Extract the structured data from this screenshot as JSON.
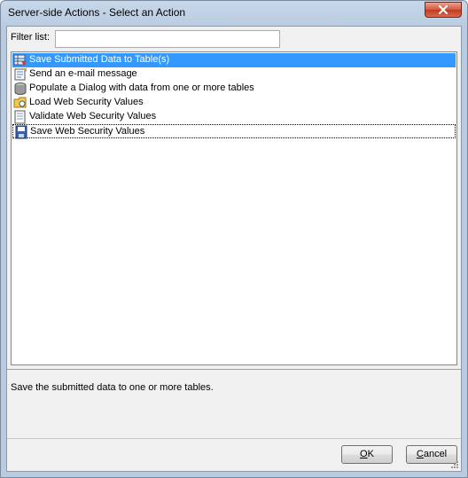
{
  "window": {
    "title": "Server-side Actions - Select an Action"
  },
  "filter": {
    "label": "Filter list:",
    "value": "",
    "placeholder": ""
  },
  "actions": [
    {
      "label": "Save Submitted Data to Table(s)",
      "icon": "save-to-table-icon",
      "selected": true
    },
    {
      "label": "Send an e-mail message",
      "icon": "email-icon",
      "selected": false
    },
    {
      "label": "Populate a Dialog with data from one or more tables",
      "icon": "database-icon",
      "selected": false
    },
    {
      "label": "Load Web Security Values",
      "icon": "load-security-icon",
      "selected": false
    },
    {
      "label": "Validate Web Security Values",
      "icon": "validate-security-icon",
      "selected": false
    },
    {
      "label": "Save Web Security Values",
      "icon": "save-security-icon",
      "selected": false
    }
  ],
  "description": "Save the submitted data to one or more tables.",
  "buttons": {
    "ok_first": "O",
    "ok_rest": "K",
    "cancel_first": "C",
    "cancel_rest": "ancel"
  },
  "colors": {
    "selection": "#3399ff",
    "dialog_bg": "#f0f0f0",
    "close_button": "#c3391e"
  }
}
